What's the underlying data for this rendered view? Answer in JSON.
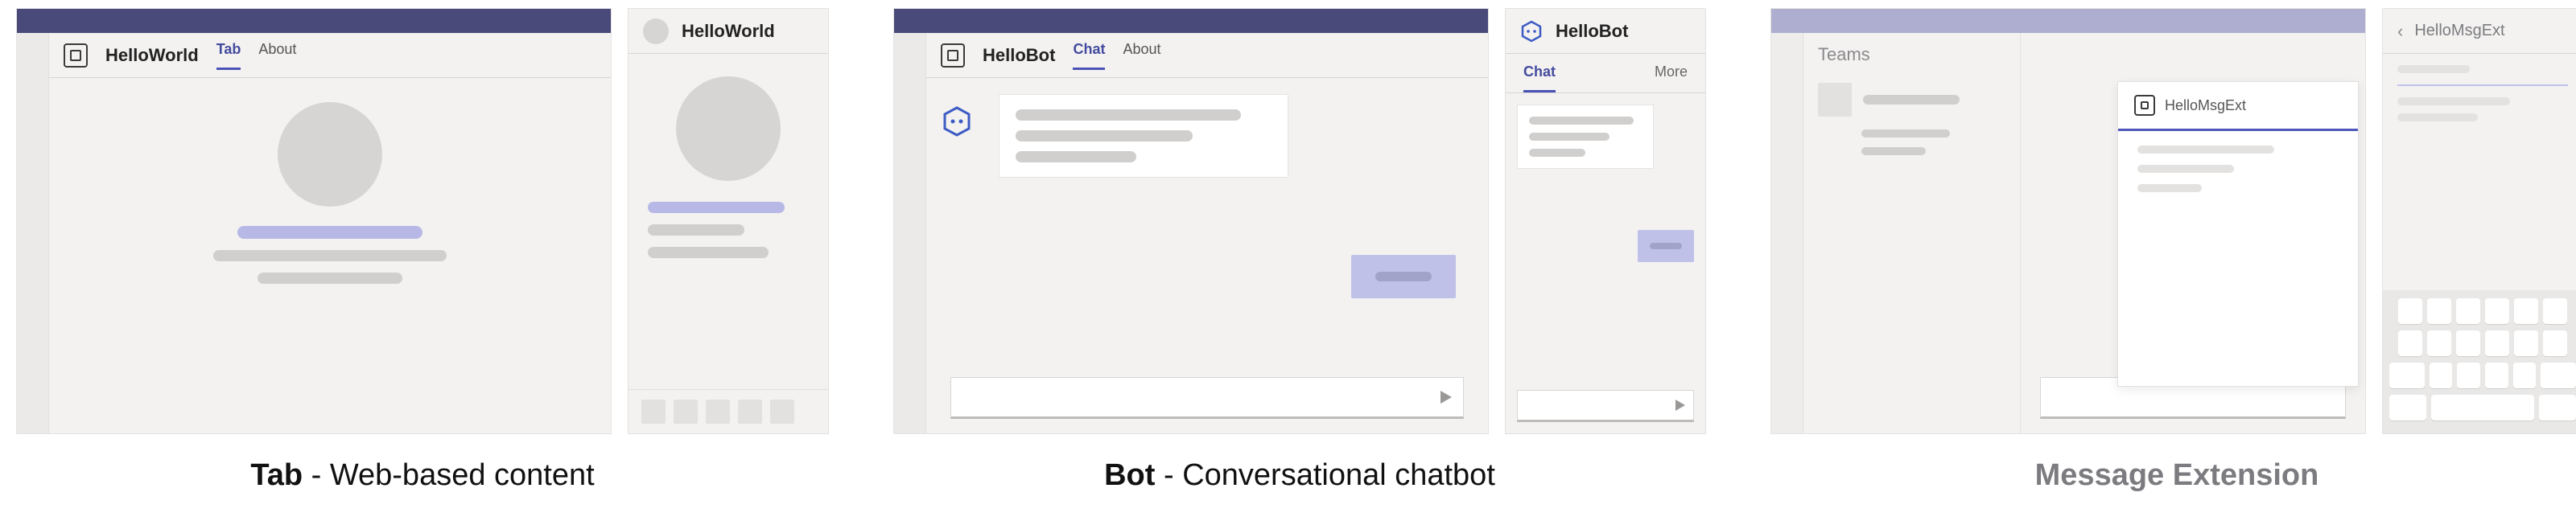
{
  "colors": {
    "titlebar": "#49497a",
    "accent": "#4a53b5",
    "accent_light": "#b7b8e6",
    "skeleton": "#d0cfcd"
  },
  "tab_group": {
    "desktop": {
      "app_name": "HelloWorld",
      "tabs": [
        {
          "label": "Tab",
          "active": true
        },
        {
          "label": "About",
          "active": false
        }
      ]
    },
    "mobile": {
      "title": "HelloWorld"
    },
    "caption_bold": "Tab",
    "caption_rest": " - Web-based content"
  },
  "bot_group": {
    "desktop": {
      "app_name": "HelloBot",
      "tabs": [
        {
          "label": "Chat",
          "active": true
        },
        {
          "label": "About",
          "active": false
        }
      ]
    },
    "mobile": {
      "title": "HelloBot",
      "tabs": [
        {
          "label": "Chat",
          "active": true
        },
        {
          "label": "More",
          "active": false
        }
      ]
    },
    "caption_bold": "Bot",
    "caption_rest": " - Conversational chatbot"
  },
  "msgext_group": {
    "desktop": {
      "sidebar_label": "Teams"
    },
    "card": {
      "title": "HelloMsgExt"
    },
    "mobile": {
      "title": "HelloMsgExt"
    },
    "caption": "Message Extension"
  }
}
